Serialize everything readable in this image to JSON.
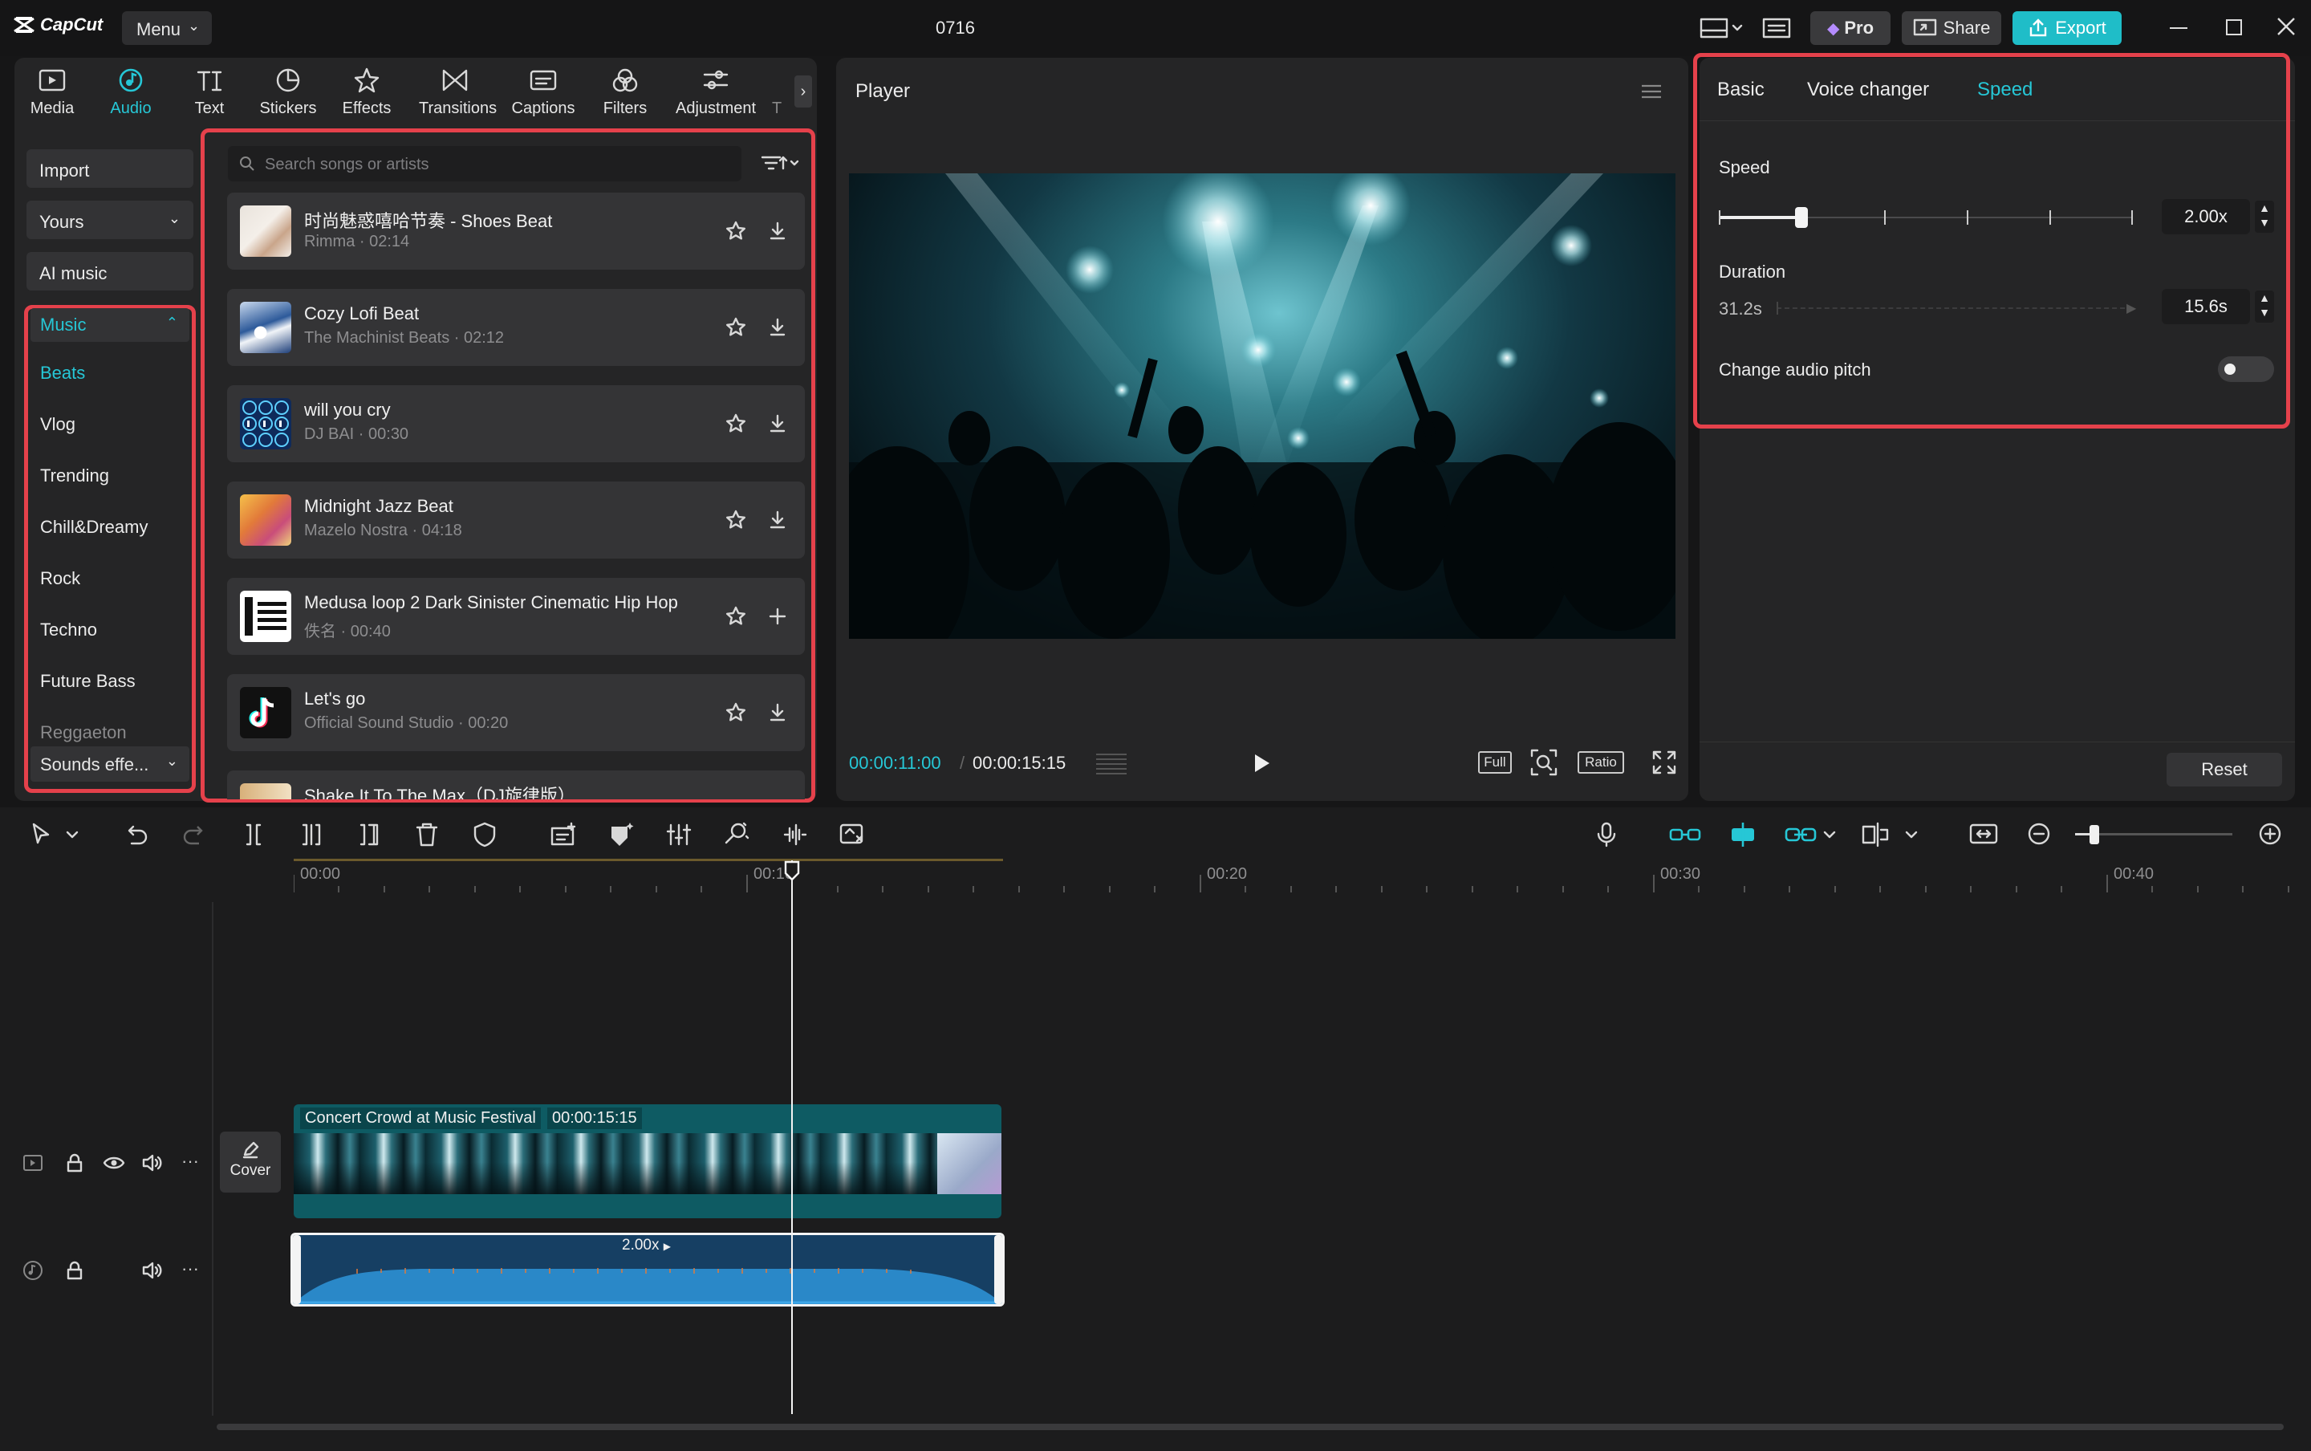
{
  "app": {
    "name": "CapCut",
    "menu": "Menu",
    "project_title": "0716",
    "pro": "Pro",
    "share": "Share",
    "export": "Export"
  },
  "colors": {
    "accent": "#26c7d6",
    "highlight": "#e5414b",
    "export_bg": "#1fbdc8",
    "clip": "#0e5b63",
    "audio": "#1f6c96"
  },
  "tool_tabs": [
    {
      "label": "Media",
      "icon": "media-icon"
    },
    {
      "label": "Audio",
      "icon": "audio-icon",
      "active": true
    },
    {
      "label": "Text",
      "icon": "text-icon"
    },
    {
      "label": "Stickers",
      "icon": "stickers-icon"
    },
    {
      "label": "Effects",
      "icon": "effects-icon"
    },
    {
      "label": "Transitions",
      "icon": "transitions-icon"
    },
    {
      "label": "Captions",
      "icon": "captions-icon"
    },
    {
      "label": "Filters",
      "icon": "filters-icon"
    },
    {
      "label": "Adjustment",
      "icon": "adjustment-icon"
    },
    {
      "label": "T",
      "icon": "more-tab"
    }
  ],
  "sidebar": {
    "import": "Import",
    "yours": "Yours",
    "ai_music": "AI music",
    "music": "Music",
    "items": [
      "Beats",
      "Vlog",
      "Trending",
      "Chill&Dreamy",
      "Rock",
      "Techno",
      "Future Bass",
      "Reggaeton"
    ],
    "sounds": "Sounds effe..."
  },
  "search": {
    "placeholder": "Search songs or artists"
  },
  "songs": [
    {
      "title": "时尚魅惑嘻哈节奏 - Shoes Beat",
      "sub": "Rimma · 02:14",
      "action": "download"
    },
    {
      "title": "Cozy Lofi Beat",
      "sub": "The Machinist Beats · 02:12",
      "action": "download"
    },
    {
      "title": "will you cry",
      "sub": "DJ BAI · 00:30",
      "action": "download"
    },
    {
      "title": "Midnight Jazz Beat",
      "sub": "Mazelo Nostra · 04:18",
      "action": "download"
    },
    {
      "title": "Medusa loop 2 Dark Sinister Cinematic Hip Hop",
      "sub": "佚名 · 00:40",
      "action": "add"
    },
    {
      "title": "Let's go",
      "sub": "Official Sound Studio · 00:20",
      "action": "download"
    },
    {
      "title": "Shake It To The Max（DJ旋律版）",
      "sub": "",
      "action": "download"
    }
  ],
  "player": {
    "title": "Player",
    "current": "00:00:11:00",
    "total": "00:00:15:15",
    "full": "Full",
    "ratio": "Ratio"
  },
  "inspector": {
    "tabs": [
      "Basic",
      "Voice changer",
      "Speed"
    ],
    "active_tab": "Speed",
    "speed_label": "Speed",
    "speed_value": "2.00x",
    "speed_fraction": 0.2,
    "duration_label": "Duration",
    "duration_original": "31.2s",
    "duration_value": "15.6s",
    "pitch_label": "Change audio pitch",
    "pitch_on": false,
    "reset": "Reset"
  },
  "timeline": {
    "ruler": [
      "00:00",
      "00:10",
      "00:20",
      "00:30",
      "00:40"
    ],
    "video_clip": {
      "name": "Concert Crowd at Music Festival",
      "duration": "00:00:15:15"
    },
    "audio_clip": {
      "speed": "2.00x"
    },
    "cover": "Cover"
  }
}
